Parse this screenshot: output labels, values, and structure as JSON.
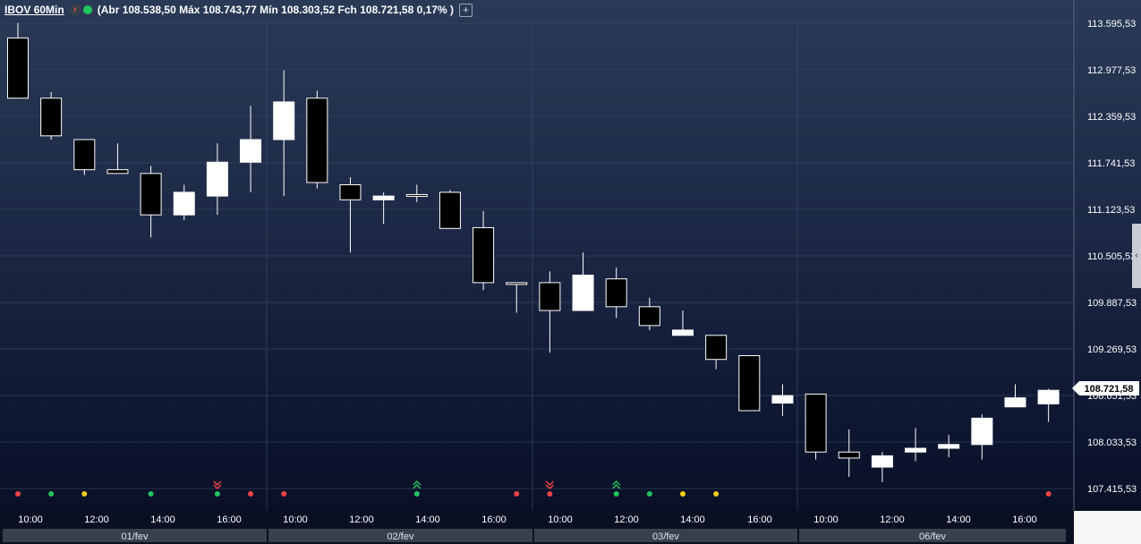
{
  "header": {
    "symbol": "IBOV",
    "timeframe": "60Min",
    "info": "(Abr 108.538,50 Máx 108.743,77 Mín 108.303,52 Fch 108.721,58 0,17% )",
    "arrow_icon": "chevron-right-icon",
    "status_color": "#22c55e"
  },
  "chart_data": {
    "type": "candlestick",
    "price_ticks": [
      "113.595,53",
      "112.977,53",
      "112.359,53",
      "111.741,53",
      "111.123,53",
      "110.505,53",
      "109.887,53",
      "109.269,53",
      "108.651,53",
      "108.033,53",
      "107.415,53"
    ],
    "last_price_label": "108.721,58",
    "time_labels": [
      "10:00",
      "12:00",
      "14:00",
      "16:00",
      "10:00",
      "12:00",
      "14:00",
      "16:00",
      "10:00",
      "12:00",
      "14:00",
      "16:00",
      "10:00",
      "12:00",
      "14:00",
      "16:00"
    ],
    "days": [
      "01/fev",
      "02/fev",
      "03/fev",
      "06/fev"
    ],
    "ylim": [
      107.3,
      113.75
    ],
    "candles": [
      {
        "o": 113.4,
        "h": 113.6,
        "l": 112.6,
        "c": 112.6
      },
      {
        "o": 112.6,
        "h": 112.68,
        "l": 112.05,
        "c": 112.1
      },
      {
        "o": 112.05,
        "h": 112.05,
        "l": 111.58,
        "c": 111.65
      },
      {
        "o": 111.65,
        "h": 112.0,
        "l": 111.6,
        "c": 111.6
      },
      {
        "o": 111.6,
        "h": 111.7,
        "l": 110.75,
        "c": 111.05
      },
      {
        "o": 111.05,
        "h": 111.45,
        "l": 110.98,
        "c": 111.35
      },
      {
        "o": 111.3,
        "h": 112.0,
        "l": 111.05,
        "c": 111.75
      },
      {
        "o": 111.75,
        "h": 112.5,
        "l": 111.35,
        "c": 112.05
      },
      {
        "o": 112.05,
        "h": 112.97,
        "l": 111.3,
        "c": 112.55
      },
      {
        "o": 112.6,
        "h": 112.7,
        "l": 111.4,
        "c": 111.48
      },
      {
        "o": 111.45,
        "h": 111.55,
        "l": 110.55,
        "c": 111.25
      },
      {
        "o": 111.25,
        "h": 111.35,
        "l": 110.93,
        "c": 111.3
      },
      {
        "o": 111.32,
        "h": 111.45,
        "l": 111.22,
        "c": 111.32
      },
      {
        "o": 111.35,
        "h": 111.38,
        "l": 110.87,
        "c": 110.87
      },
      {
        "o": 110.88,
        "h": 111.1,
        "l": 110.05,
        "c": 110.15
      },
      {
        "o": 110.15,
        "h": 110.15,
        "l": 109.75,
        "c": 110.15
      },
      {
        "o": 110.15,
        "h": 110.3,
        "l": 109.22,
        "c": 109.78
      },
      {
        "o": 109.78,
        "h": 110.55,
        "l": 109.78,
        "c": 110.25
      },
      {
        "o": 110.2,
        "h": 110.35,
        "l": 109.68,
        "c": 109.83
      },
      {
        "o": 109.83,
        "h": 109.95,
        "l": 109.52,
        "c": 109.58
      },
      {
        "o": 109.45,
        "h": 109.78,
        "l": 109.45,
        "c": 109.52
      },
      {
        "o": 109.45,
        "h": 109.45,
        "l": 109.0,
        "c": 109.13
      },
      {
        "o": 109.18,
        "h": 109.18,
        "l": 108.45,
        "c": 108.45
      },
      {
        "o": 108.55,
        "h": 108.8,
        "l": 108.38,
        "c": 108.65
      },
      {
        "o": 108.67,
        "h": 108.67,
        "l": 107.8,
        "c": 107.9
      },
      {
        "o": 107.9,
        "h": 108.2,
        "l": 107.57,
        "c": 107.82
      },
      {
        "o": 107.7,
        "h": 107.9,
        "l": 107.5,
        "c": 107.85
      },
      {
        "o": 107.9,
        "h": 108.22,
        "l": 107.78,
        "c": 107.95
      },
      {
        "o": 107.95,
        "h": 108.13,
        "l": 107.83,
        "c": 108.0
      },
      {
        "o": 108.0,
        "h": 108.4,
        "l": 107.8,
        "c": 108.35
      },
      {
        "o": 108.5,
        "h": 108.8,
        "l": 108.5,
        "c": 108.62
      },
      {
        "o": 108.54,
        "h": 108.74,
        "l": 108.3,
        "c": 108.72
      }
    ],
    "markers": [
      {
        "i": 0,
        "color": "#ef4444"
      },
      {
        "i": 1,
        "color": "#22c55e"
      },
      {
        "i": 2,
        "color": "#facc15"
      },
      {
        "i": 4,
        "color": "#22c55e"
      },
      {
        "i": 6,
        "color": "#22c55e",
        "arrow": "down",
        "arrow_color": "#ef4444"
      },
      {
        "i": 7,
        "color": "#ef4444"
      },
      {
        "i": 8,
        "color": "#ef4444"
      },
      {
        "i": 12,
        "color": "#22c55e",
        "arrow": "up",
        "arrow_color": "#22c55e"
      },
      {
        "i": 15,
        "color": "#ef4444"
      },
      {
        "i": 16,
        "color": "#ef4444",
        "arrow": "down",
        "arrow_color": "#ef4444"
      },
      {
        "i": 18,
        "color": "#22c55e",
        "arrow": "up",
        "arrow_color": "#22c55e"
      },
      {
        "i": 19,
        "color": "#22c55e"
      },
      {
        "i": 20,
        "color": "#facc15"
      },
      {
        "i": 21,
        "color": "#facc15"
      },
      {
        "i": 31,
        "color": "#ef4444"
      }
    ],
    "colors": {
      "up": "#ffffff",
      "down": "#000000",
      "axis_text": "#ffffff",
      "grid": "#3a4a66"
    }
  }
}
